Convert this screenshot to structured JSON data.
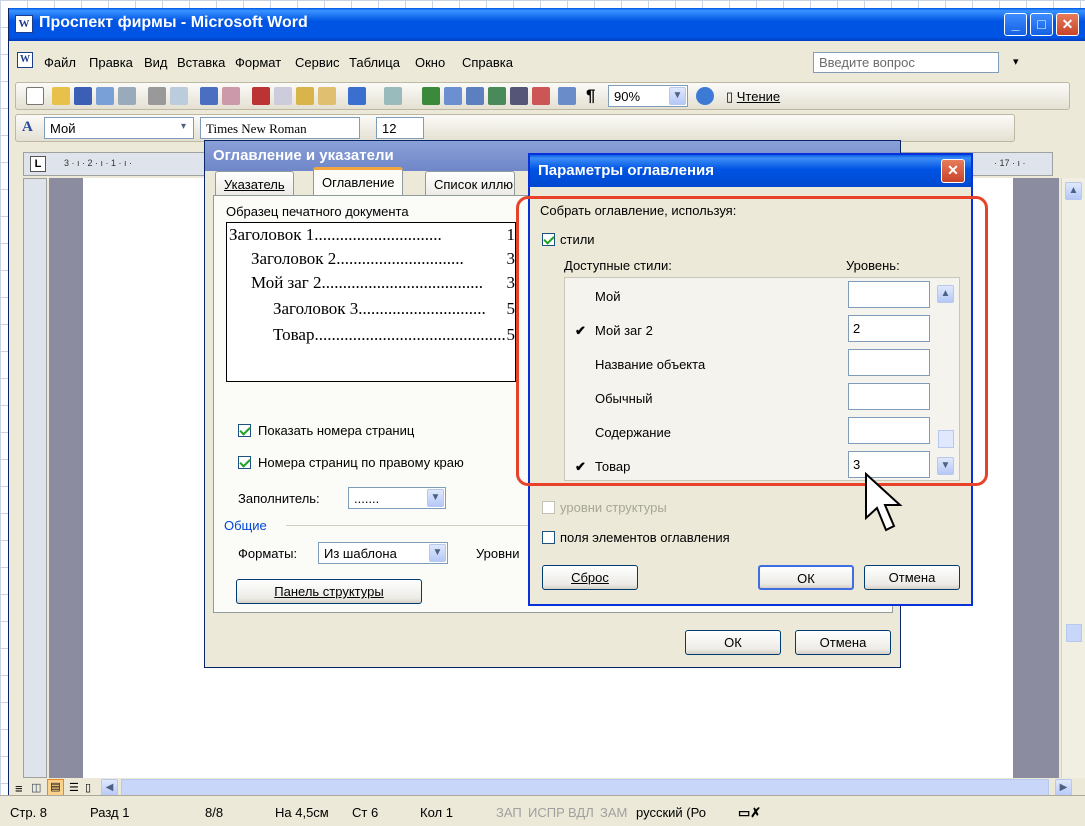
{
  "window": {
    "title": "Проспект фирмы - Microsoft Word",
    "caption_minimize": "_",
    "caption_maximize": "□",
    "caption_close": "✕"
  },
  "menu": [
    "Файл",
    "Правка",
    "Вид",
    "Вставка",
    "Формат",
    "Сервис",
    "Таблица",
    "Окно",
    "Справка"
  ],
  "ask_placeholder": "Введите вопрос",
  "toolbar": {
    "zoom": "90%",
    "reading": "Чтение"
  },
  "format_bar": {
    "style": "Мой",
    "font": "Times New Roman",
    "size": "12"
  },
  "ruler_numbers": "3 · ı · 2 · ı · 1 · ı ·",
  "ruler_right": "· 17 · ı ·",
  "toc_dialog": {
    "title": "Оглавление и указатели",
    "tabs": [
      "Указатель",
      "Оглавление",
      "Список иллю"
    ],
    "preview_label": "Образец печатного документа",
    "preview_lines": [
      {
        "text": "Заголовок 1",
        "page": "1"
      },
      {
        "text": "Заголовок 2",
        "page": "3"
      },
      {
        "text": "Мой заг 2",
        "page": "3"
      },
      {
        "text": "Заголовок 3",
        "page": "5"
      },
      {
        "text": "Товар",
        "page": "5"
      }
    ],
    "show_page_numbers": "Показать номера страниц",
    "right_align": "Номера страниц по правому краю",
    "leader_label": "Заполнитель:",
    "leader_value": ".......",
    "general": "Общие",
    "formats_label": "Форматы:",
    "formats_value": "Из шаблона",
    "levels_label": "Уровни",
    "outline_button": "Панель структуры",
    "ok": "ОК",
    "cancel": "Отмена"
  },
  "options_dialog": {
    "title": "Параметры оглавления",
    "build_from": "Собрать оглавление, используя:",
    "styles_check": "стили",
    "available_styles": "Доступные стили:",
    "level_header": "Уровень:",
    "styles": [
      {
        "name": "Мой",
        "level": "",
        "checked": false
      },
      {
        "name": "Мой заг 2",
        "level": "2",
        "checked": true
      },
      {
        "name": "Название объекта",
        "level": "",
        "checked": false
      },
      {
        "name": "Обычный",
        "level": "",
        "checked": false
      },
      {
        "name": "Содержание",
        "level": "",
        "checked": false
      },
      {
        "name": "Товар",
        "level": "3",
        "checked": true
      }
    ],
    "outline_levels": "уровни структуры",
    "toc_fields": "поля элементов оглавления",
    "reset": "Сброс",
    "ok": "ОК",
    "cancel": "Отмена",
    "highlight_color": "#e8432a"
  },
  "status": {
    "page": "Стр. 8",
    "section": "Разд 1",
    "pages": "8/8",
    "at": "На 4,5см",
    "line": "Ст 6",
    "col": "Кол 1",
    "rec": "ЗАП",
    "trk": "ИСПР",
    "ext": "ВДЛ",
    "ovr": "ЗАМ",
    "lang": "русский (Ро"
  }
}
